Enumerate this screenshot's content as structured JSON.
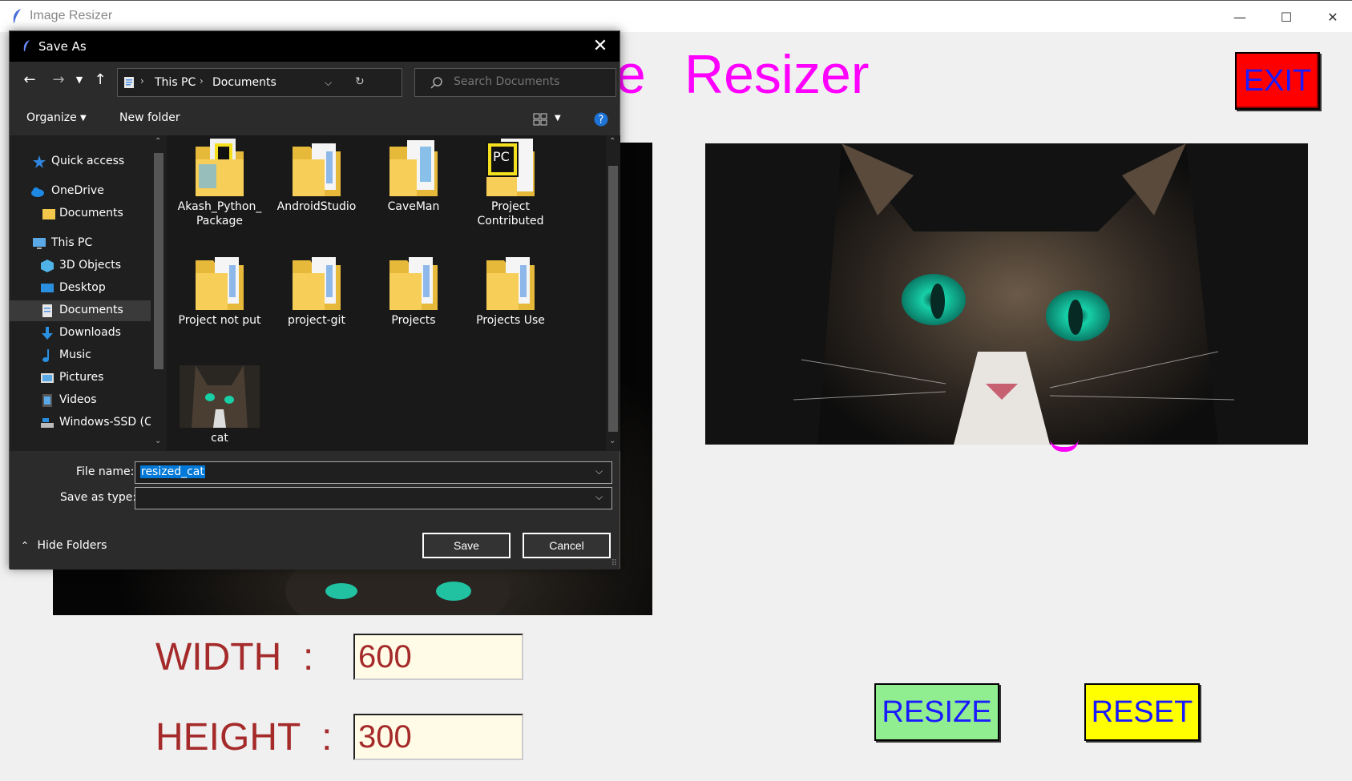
{
  "window": {
    "title": "Image Resizer",
    "minimize": "—",
    "maximize": "☐",
    "close": "✕"
  },
  "app": {
    "heading_partial": "e",
    "heading": "Resizer",
    "exit_label": "EXIT",
    "width_label": "WIDTH  :",
    "height_label": "HEIGHT  :",
    "width_value": "600",
    "height_value": "300",
    "resize_label": "RESIZE",
    "reset_label": "RESET"
  },
  "dialog": {
    "title": "Save As",
    "address": [
      "This PC",
      "Documents"
    ],
    "search_placeholder": "Search Documents",
    "organize": "Organize",
    "new_folder": "New folder",
    "nav": [
      {
        "label": "Quick access",
        "icon": "star-icon"
      },
      {
        "label": "OneDrive",
        "icon": "cloud-icon"
      },
      {
        "label": "Documents",
        "icon": "folder-icon"
      },
      {
        "label": "This PC",
        "icon": "computer-icon"
      },
      {
        "label": "3D Objects",
        "icon": "cube-icon"
      },
      {
        "label": "Desktop",
        "icon": "desktop-icon"
      },
      {
        "label": "Documents",
        "icon": "document-icon"
      },
      {
        "label": "Downloads",
        "icon": "download-icon"
      },
      {
        "label": "Music",
        "icon": "music-icon"
      },
      {
        "label": "Pictures",
        "icon": "pictures-icon"
      },
      {
        "label": "Videos",
        "icon": "videos-icon"
      },
      {
        "label": "Windows-SSD (C",
        "icon": "drive-icon"
      }
    ],
    "files": [
      {
        "line1": "Akash_Python_",
        "line2": "Package"
      },
      {
        "line1": "AndroidStudio",
        "line2": ""
      },
      {
        "line1": "CaveMan",
        "line2": ""
      },
      {
        "line1": "Project",
        "line2": "Contributed"
      },
      {
        "line1": "Project not put",
        "line2": ""
      },
      {
        "line1": "project-git",
        "line2": ""
      },
      {
        "line1": "Projects",
        "line2": ""
      },
      {
        "line1": "Projects Use",
        "line2": ""
      },
      {
        "line1": "cat",
        "line2": ""
      }
    ],
    "file_name_label": "File name:",
    "file_name_value": "resized_cat",
    "save_type_label": "Save as type:",
    "save_type_value": "",
    "save_label": "Save",
    "cancel_label": "Cancel",
    "hide_folders": "Hide Folders"
  },
  "colors": {
    "heading": "#ff00ff",
    "exit_bg": "#ff0000",
    "resize_bg": "#90ee90",
    "reset_bg": "#ffff00",
    "button_text": "#1a1aff",
    "label_text": "#a52a2a",
    "entry_bg": "#fffbe6"
  }
}
